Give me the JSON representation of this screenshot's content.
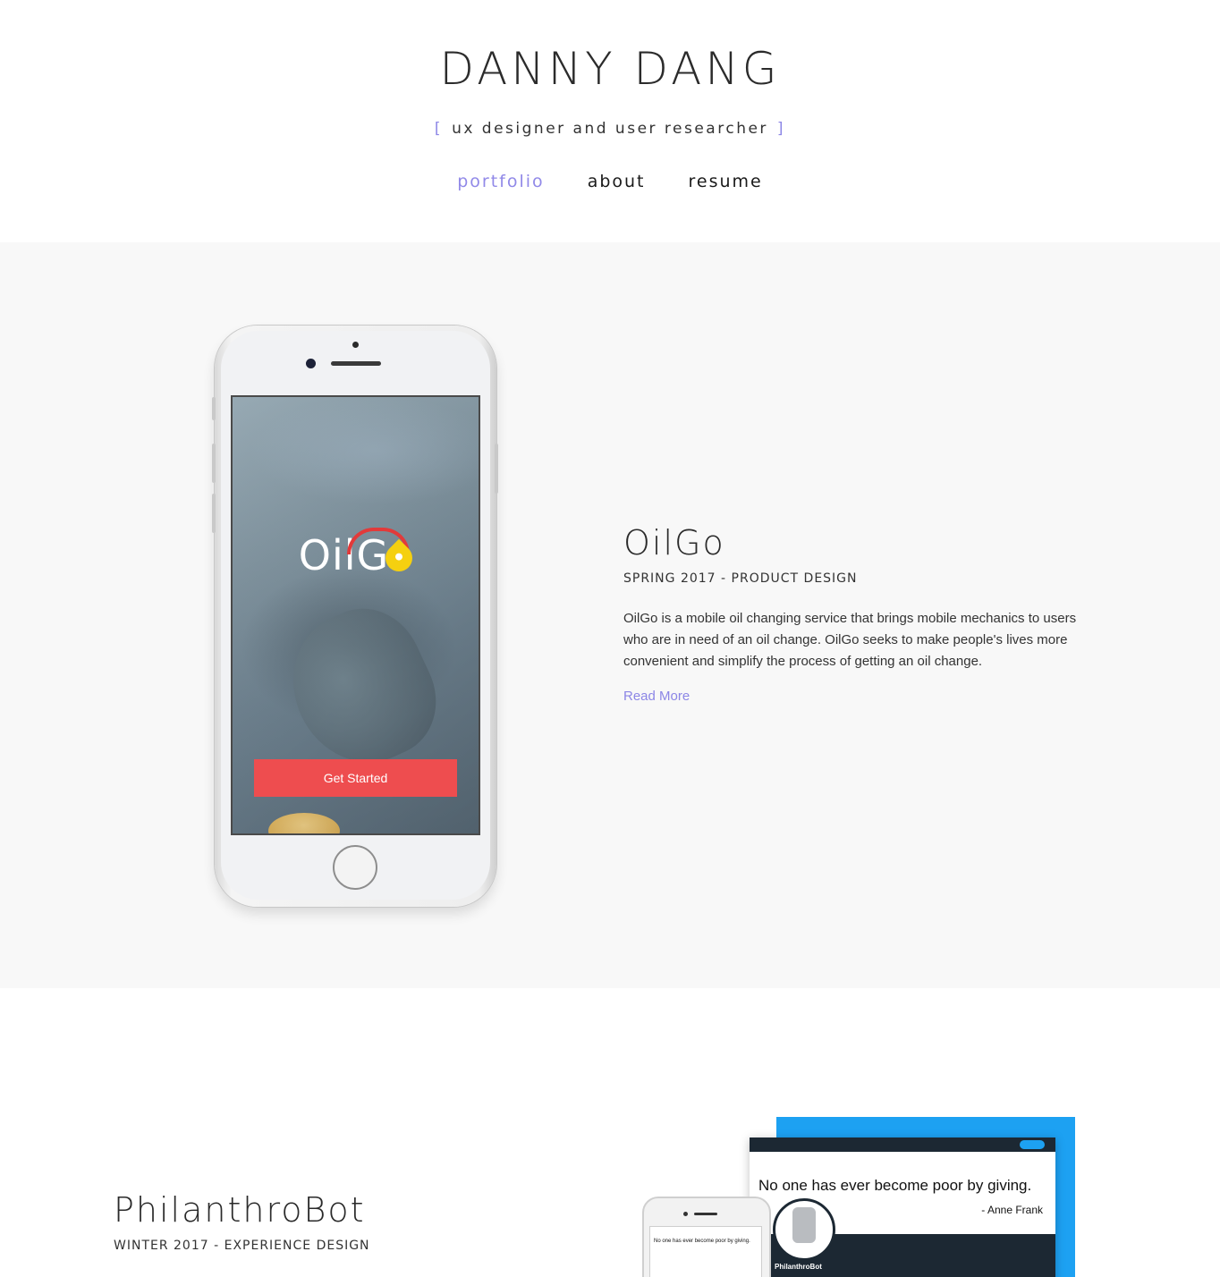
{
  "header": {
    "name": "DANNY DANG",
    "tagline_open": "[",
    "tagline": "ux designer and user researcher",
    "tagline_close": "]"
  },
  "nav": {
    "items": [
      {
        "label": "portfolio",
        "active": true
      },
      {
        "label": "about",
        "active": false
      },
      {
        "label": "resume",
        "active": false
      }
    ]
  },
  "projects": [
    {
      "title": "OilGo",
      "meta": "SPRING 2017 - PRODUCT DESIGN",
      "description": "OilGo is a mobile oil changing service that brings mobile mechanics to users who are in need of an oil change. OilGo seeks to make people's lives more convenient and simplify the process of getting an oil change.",
      "link_label": "Read More",
      "mockup": {
        "logo_text": "OilG",
        "button_label": "Get Started"
      }
    },
    {
      "title": "PhilanthroBot",
      "meta": "WINTER 2017 - EXPERIENCE DESIGN",
      "mockup": {
        "quote": "No one has ever become poor by giving.",
        "author": "- Anne Frank",
        "profile_name": "PhilanthroBot"
      }
    }
  ],
  "colors": {
    "accent": "#8c86e6",
    "section_bg": "#f8f8f8",
    "oilgo_button": "#ee4d4f",
    "twitter_blue": "#1da1f2"
  }
}
